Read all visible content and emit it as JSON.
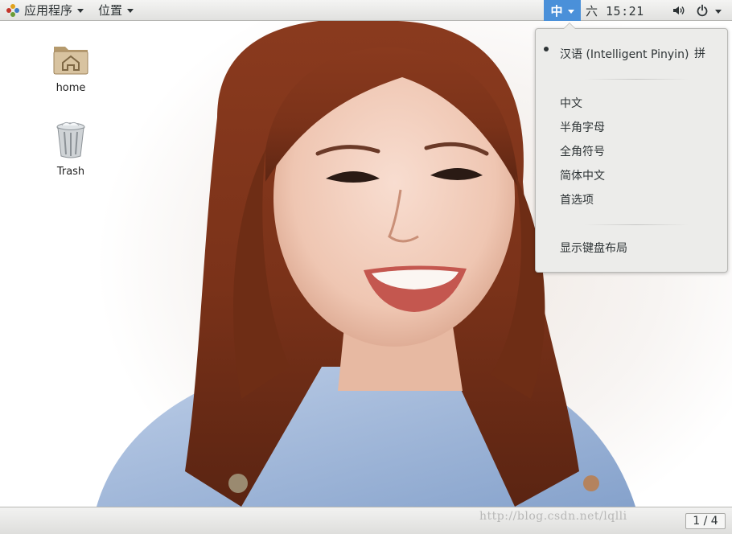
{
  "topbar": {
    "applications_label": "应用程序",
    "places_label": "位置",
    "input_method_label": "中",
    "clock": "六 15:21",
    "icons": {
      "apps": "gnome-foot-icon",
      "volume": "volume-icon",
      "power": "power-icon"
    }
  },
  "desktop": {
    "icons": [
      {
        "label": "home",
        "icon": "home-folder-icon"
      },
      {
        "label": "Trash",
        "icon": "trash-icon"
      }
    ],
    "wallpaper": "portrait-photo"
  },
  "input_menu": {
    "active_engine": "汉语 (Intelligent Pinyin)",
    "active_engine_indicator": "拼",
    "items": [
      "中文",
      "半角字母",
      "全角符号",
      "简体中文",
      "首选项"
    ],
    "show_keyboard_layout": "显示键盘布局"
  },
  "bottombar": {
    "workspace_indicator": "1 / 4",
    "watermark": "http://blog.csdn.net/lqlli"
  },
  "colors": {
    "accent": "#4a90d9",
    "panel": "#e6e6e4",
    "menu_bg": "#ececea"
  }
}
